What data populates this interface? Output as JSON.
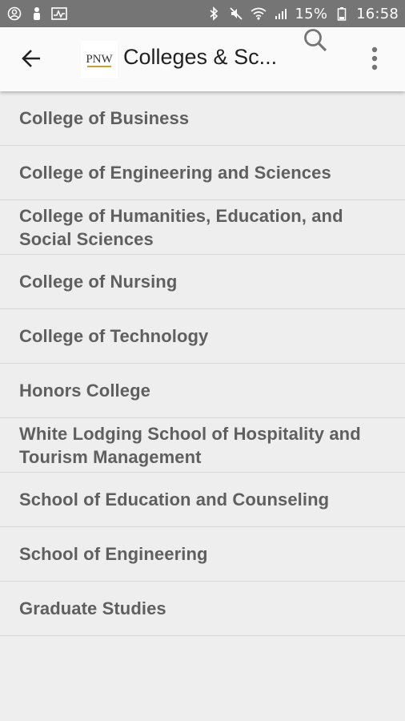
{
  "status_bar": {
    "battery": "15%",
    "time": "16:58",
    "left_icons": [
      "account-circle-icon",
      "person-icon",
      "activity-icon"
    ],
    "right_icons": [
      "bluetooth-icon",
      "mute-icon",
      "wifi-icon",
      "signal-icon",
      "battery-icon"
    ]
  },
  "app_bar": {
    "title": "Colleges & Sc...",
    "logo_text": "PNW",
    "accent_color": "#c9a227"
  },
  "colleges": [
    "College of Business",
    "College of Engineering and Sciences",
    "College of Humanities, Education, and Social Sciences",
    "College of Nursing",
    "College of Technology",
    "Honors College",
    "White Lodging School of Hospitality and Tourism Management",
    "School of Education and Counseling",
    "School of Engineering",
    "Graduate Studies"
  ]
}
